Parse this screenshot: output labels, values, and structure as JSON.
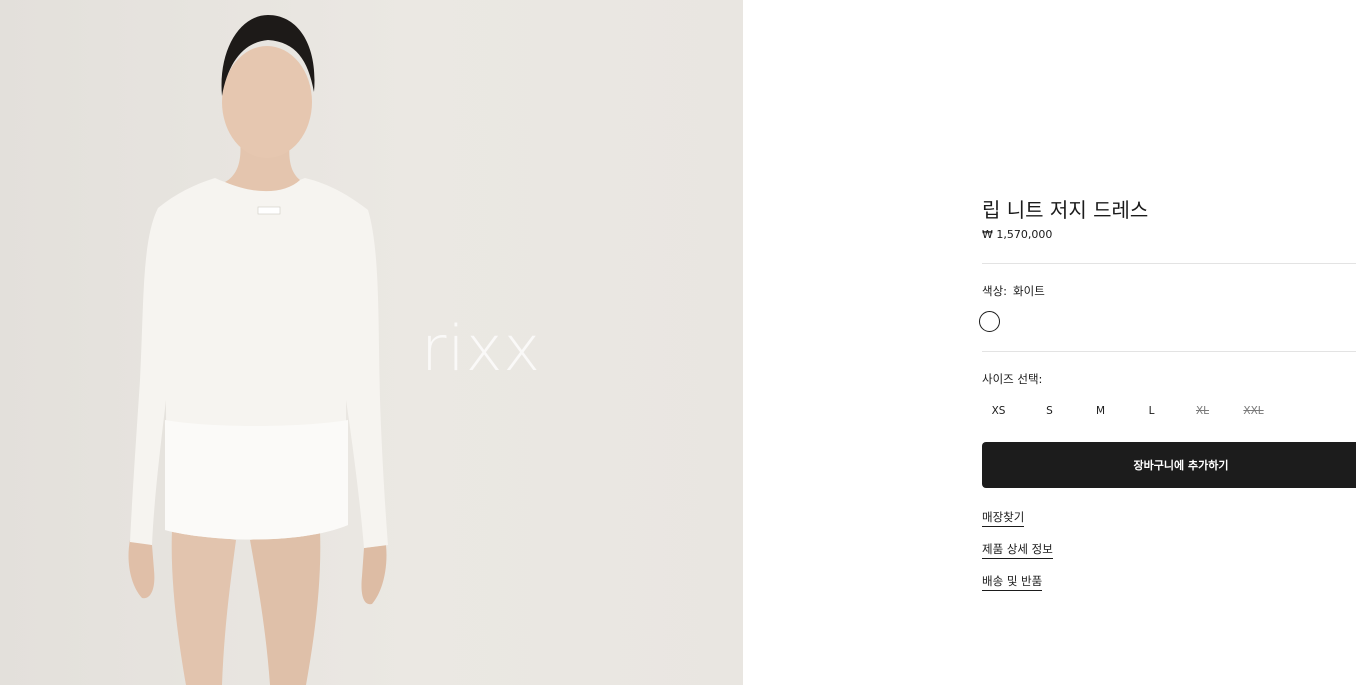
{
  "watermark": "rixx",
  "product": {
    "title": "립 니트 저지 드레스",
    "price": "₩ 1,570,000"
  },
  "color": {
    "label": "색상:",
    "value": "화이트",
    "swatch_hex": "#ffffff"
  },
  "size": {
    "label": "사이즈 선택:",
    "options": [
      {
        "label": "XS",
        "available": true
      },
      {
        "label": "S",
        "available": true
      },
      {
        "label": "M",
        "available": true
      },
      {
        "label": "L",
        "available": true
      },
      {
        "label": "XL",
        "available": false
      },
      {
        "label": "XXL",
        "available": false
      }
    ]
  },
  "actions": {
    "add_to_cart": "장바구니에 추가하기"
  },
  "links": {
    "store_finder": "매장찾기",
    "product_details": "제품 상세 정보",
    "shipping_returns": "배송 및 반품"
  },
  "colors": {
    "button_bg": "#1c1c1c",
    "image_bg": "#e8e5e0"
  }
}
